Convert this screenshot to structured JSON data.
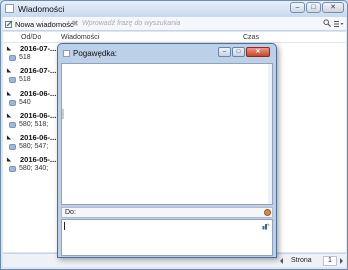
{
  "window": {
    "title": "Wiadomości"
  },
  "toolbar": {
    "new_message_label": "Nowa wiadomość",
    "search_placeholder": "Wprowadź frazę do wyszukania"
  },
  "columns": {
    "from_to": "Od/Do",
    "messages": "Wiadomości",
    "time": "Czas"
  },
  "rows": [
    {
      "date": "2016-07-...",
      "ids": "518"
    },
    {
      "date": "2016-07-...",
      "ids": "518"
    },
    {
      "date": "2016-06-...",
      "ids": "540"
    },
    {
      "date": "2016-06-...",
      "ids": "580; 518;"
    },
    {
      "date": "2016-06-...",
      "ids": "580; 547;"
    },
    {
      "date": "2016-05-...",
      "ids": "580; 340;"
    }
  ],
  "statusbar": {
    "page_label": "Strona",
    "page_number": "1"
  },
  "dialog": {
    "title": "Pogawędka:",
    "to_label": "Do:",
    "message_value": ""
  },
  "colors": {
    "accent": "#4f6e96",
    "close": "#c8452d"
  }
}
